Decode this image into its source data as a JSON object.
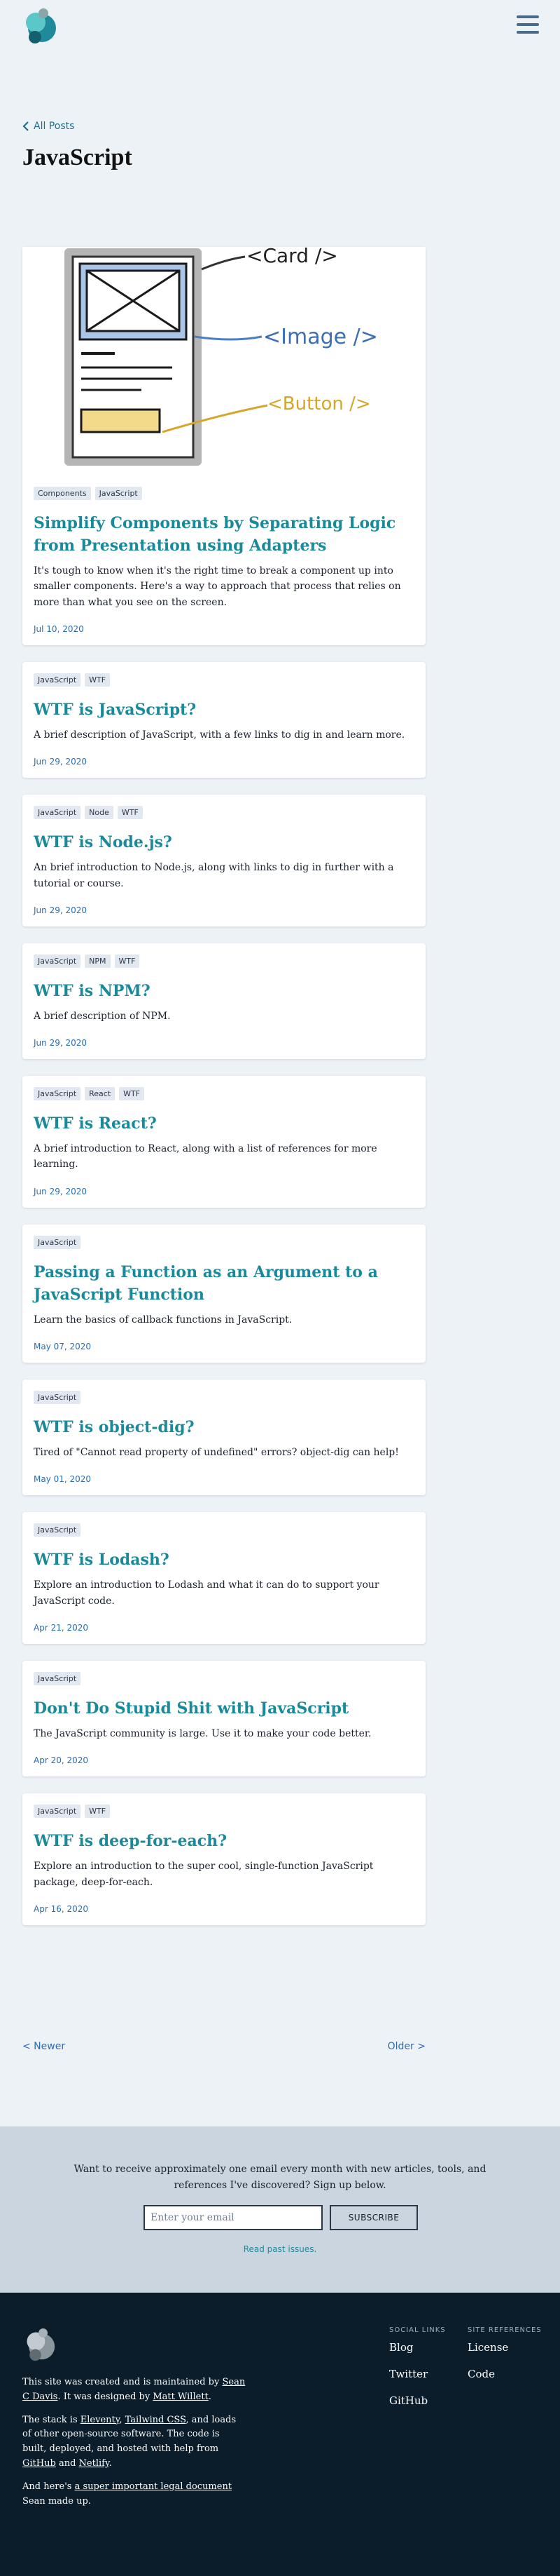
{
  "header": {
    "back_label": "All Posts",
    "page_title": "JavaScript"
  },
  "featured_image": {
    "labels": [
      "<Card />",
      "<Image />",
      "<Button />"
    ]
  },
  "posts": [
    {
      "tags": [
        "Components",
        "JavaScript"
      ],
      "title": "Simplify Components by Separating Logic from Presentation using Adapters",
      "description": "It's tough to know when it's the right time to break a component up into smaller components. Here's a way to approach that process that relies on more than what you see on the screen.",
      "date": "Jul 10, 2020"
    },
    {
      "tags": [
        "JavaScript",
        "WTF"
      ],
      "title": "WTF is JavaScript?",
      "description": "A brief description of JavaScript, with a few links to dig in and learn more.",
      "date": "Jun 29, 2020"
    },
    {
      "tags": [
        "JavaScript",
        "Node",
        "WTF"
      ],
      "title": "WTF is Node.js?",
      "description": "An brief introduction to Node.js, along with links to dig in further with a tutorial or course.",
      "date": "Jun 29, 2020"
    },
    {
      "tags": [
        "JavaScript",
        "NPM",
        "WTF"
      ],
      "title": "WTF is NPM?",
      "description": "A brief description of NPM.",
      "date": "Jun 29, 2020"
    },
    {
      "tags": [
        "JavaScript",
        "React",
        "WTF"
      ],
      "title": "WTF is React?",
      "description": "A brief introduction to React, along with a list of references for more learning.",
      "date": "Jun 29, 2020"
    },
    {
      "tags": [
        "JavaScript"
      ],
      "title": "Passing a Function as an Argument to a JavaScript Function",
      "description": "Learn the basics of callback functions in JavaScript.",
      "date": "May 07, 2020"
    },
    {
      "tags": [
        "JavaScript"
      ],
      "title": "WTF is object-dig?",
      "description": "Tired of \"Cannot read property of undefined\" errors? object-dig can help!",
      "date": "May 01, 2020"
    },
    {
      "tags": [
        "JavaScript"
      ],
      "title": "WTF is Lodash?",
      "description": "Explore an introduction to Lodash and what it can do to support your JavaScript code.",
      "date": "Apr 21, 2020"
    },
    {
      "tags": [
        "JavaScript"
      ],
      "title": "Don't Do Stupid Shit with JavaScript",
      "description": "The JavaScript community is large. Use it to make your code better.",
      "date": "Apr 20, 2020"
    },
    {
      "tags": [
        "JavaScript",
        "WTF"
      ],
      "title": "WTF is deep-for-each?",
      "description": "Explore an introduction to the super cool, single-function JavaScript package, deep-for-each.",
      "date": "Apr 16, 2020"
    }
  ],
  "pager": {
    "newer": "< Newer",
    "older": "Older >"
  },
  "newsletter": {
    "text": "Want to receive approximately one email every month with new articles, tools, and references I've discovered? Sign up below.",
    "placeholder": "Enter your email",
    "button": "SUBSCRIBE",
    "past_link": "Read past issues."
  },
  "footer": {
    "created_prefix": "This site was created and is maintained by ",
    "author": "Sean C Davis",
    "designed_prefix": ". It was designed by ",
    "designer": "Matt Willett",
    "designed_suffix": ".",
    "stack_prefix": "The stack is ",
    "eleventy": "Eleventy",
    "comma": ", ",
    "tailwind": "Tailwind CSS",
    "stack_mid": ", and loads of other open-source software. The code is built, deployed, and hosted with help from ",
    "github": "GitHub",
    "and": " and ",
    "netlify": "Netlify",
    "period": ".",
    "legal_prefix": "And here's ",
    "legal_link": "a super important legal document",
    "legal_suffix": " Sean made up.",
    "social_heading": "Social Links",
    "social_links": [
      "Blog",
      "Twitter",
      "GitHub"
    ],
    "refs_heading": "Site References",
    "refs_links": [
      "License",
      "Code"
    ]
  },
  "colors": {
    "accent": "#1a8a9a",
    "date": "#2b6cb0",
    "background": "#edf2f7",
    "footer_bg": "#0b1d2a"
  }
}
